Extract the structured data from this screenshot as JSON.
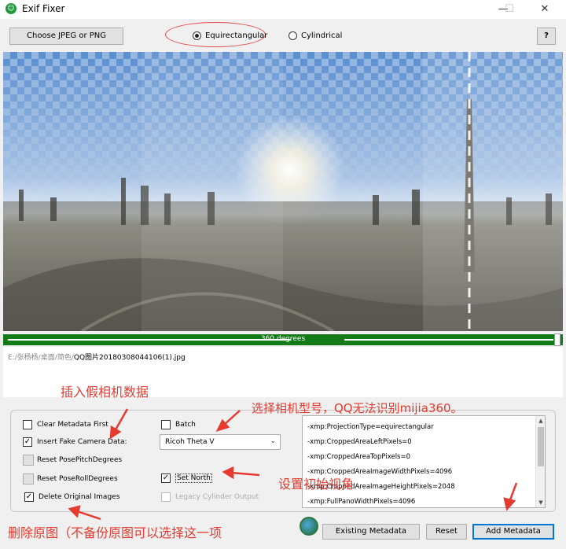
{
  "window": {
    "title": "Exif Fixer",
    "icon": "exif-fixer-app-icon",
    "minimize": "—",
    "maximize": "☐",
    "close": "✕"
  },
  "toolbar": {
    "choose_label": "Choose JPEG or PNG",
    "projection_options": [
      {
        "label": "Equirectangular",
        "selected": true
      },
      {
        "label": "Cylindrical",
        "selected": false
      }
    ],
    "help_label": "?"
  },
  "degree_bar": {
    "label": "360 degrees",
    "color": "#127a17"
  },
  "file": {
    "path_prefix": "E:/张杨杨/桌面/简色/",
    "file_name": "QQ图片20180308044106(1).jpg"
  },
  "options": {
    "clear_metadata": {
      "label": "Clear Metadata First",
      "checked": false
    },
    "insert_fake_camera": {
      "label": "Insert Fake Camera Data:",
      "checked": true
    },
    "reset_pitch": {
      "label": "Reset PosePitchDegrees"
    },
    "reset_roll": {
      "label": "Reset PoseRollDegrees"
    },
    "delete_original": {
      "label": "Delete Original Images",
      "checked": true
    },
    "batch": {
      "label": "Batch",
      "checked": false
    },
    "camera_select": {
      "value": "Ricoh Theta V"
    },
    "set_north": {
      "label": "Set North",
      "checked": true
    },
    "legacy_cylinder": {
      "label": "Legacy Cylinder Output",
      "checked": false,
      "disabled": true
    }
  },
  "metadata_lines": [
    "-xmp:ProjectionType=equirectangular",
    "-xmp:CroppedAreaLeftPixels=0",
    "-xmp:CroppedAreaTopPixels=0",
    "-xmp:CroppedAreaImageWidthPixels=4096",
    "-xmp:CroppedAreaImageHeightPixels=2048",
    "-xmp:FullPanoWidthPixels=4096"
  ],
  "actions": {
    "existing_label": "Existing Metadata",
    "reset_label": "Reset",
    "add_label": "Add Metadata"
  },
  "annotations": {
    "fake_camera": "插入假相机数据",
    "select_model": "选择相机型号，QQ无法识别mijia360。",
    "set_view": "设置初始视角",
    "delete_original": "删除原图（不备份原图可以选择这一项"
  },
  "colors": {
    "annotation_red": "#e53a2f",
    "selection_blue": "#0078d7"
  }
}
